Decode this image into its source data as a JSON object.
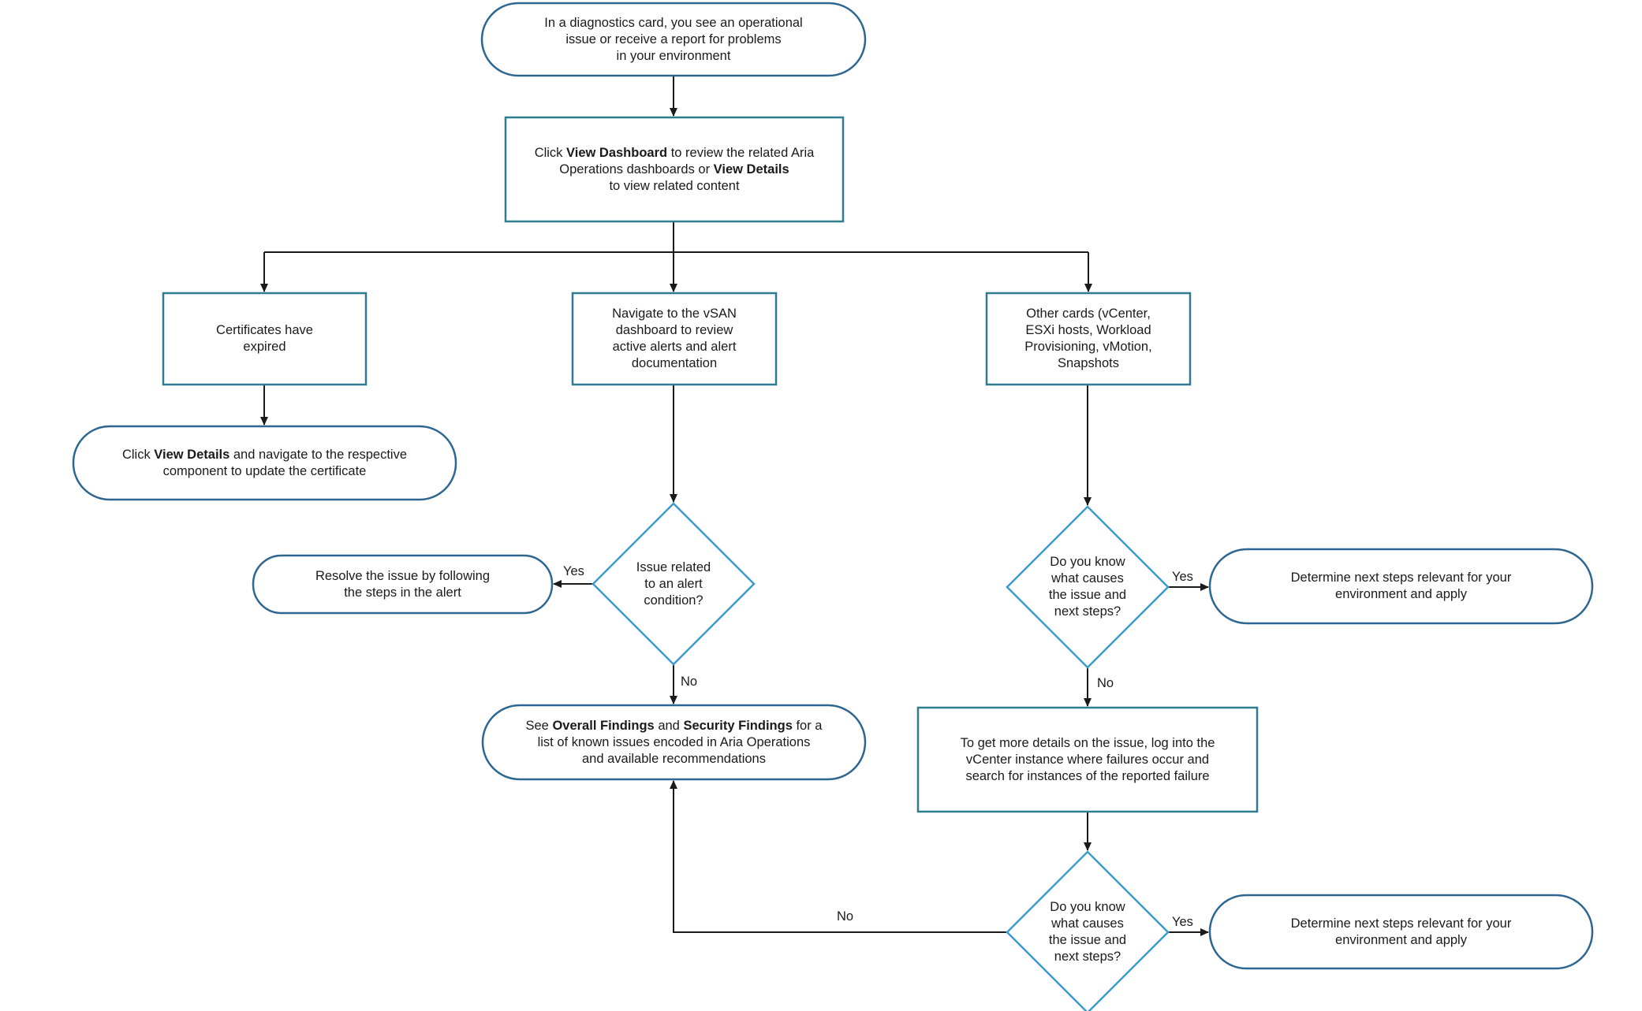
{
  "colors": {
    "pill_border": "#2d6690",
    "box_border": "#2e7d8f",
    "diamond_border": "#3d9bcb",
    "connector": "#1a1a1a",
    "text": "#1a1a1a"
  },
  "nodes": {
    "start": {
      "type": "terminator",
      "lines": [
        "In a diagnostics  card, you see an operational",
        "issue or receive a report for problems",
        "in your environment"
      ]
    },
    "view_dashboard": {
      "type": "process",
      "segments": [
        {
          "text": "Click ",
          "bold": false
        },
        {
          "text": "View Dashboard",
          "bold": true
        },
        {
          "text": " to review the related Aria\nOperations dashboards or ",
          "bold": false
        },
        {
          "text": "View Details",
          "bold": true
        },
        {
          "text": "\nto view related content",
          "bold": false
        }
      ]
    },
    "certificates_expired": {
      "type": "process",
      "lines": [
        "Certificates have",
        "expired"
      ]
    },
    "update_certificate": {
      "type": "terminator",
      "segments": [
        {
          "text": "Click ",
          "bold": false
        },
        {
          "text": "View Details",
          "bold": true
        },
        {
          "text": " and navigate to the respective\ncomponent to update the certificate",
          "bold": false
        }
      ]
    },
    "vsan_dashboard": {
      "type": "process",
      "lines": [
        "Navigate to the vSAN",
        "dashboard to review",
        "active alerts and alert",
        "documentation"
      ]
    },
    "other_cards": {
      "type": "process",
      "lines": [
        "Other cards (vCenter,",
        "ESXi hosts, Workload",
        "Provisioning, vMotion,",
        "Snapshots"
      ]
    },
    "alert_decision": {
      "type": "decision",
      "lines": [
        "Issue related",
        "to an alert",
        "condition?"
      ]
    },
    "resolve_alert": {
      "type": "terminator",
      "lines": [
        "Resolve the issue by following",
        "the steps in the alert"
      ]
    },
    "findings": {
      "type": "terminator",
      "segments": [
        {
          "text": "See ",
          "bold": false
        },
        {
          "text": "Overall Findings",
          "bold": true
        },
        {
          "text": " and ",
          "bold": false
        },
        {
          "text": "Security Findings",
          "bold": true
        },
        {
          "text": " for a\nlist of known issues encoded in Aria Operations\nand available recommendations",
          "bold": false
        }
      ]
    },
    "know_cause_1": {
      "type": "decision",
      "lines": [
        "Do you know",
        "what causes",
        "the issue and",
        "next steps?"
      ]
    },
    "next_steps_1": {
      "type": "terminator",
      "lines": [
        "Determine next steps relevant for your",
        "environment and apply"
      ]
    },
    "vcenter_details": {
      "type": "process",
      "lines": [
        "To get more details on the issue, log into the",
        "vCenter instance where failures occur and",
        "search for instances of the reported failure"
      ]
    },
    "know_cause_2": {
      "type": "decision",
      "lines": [
        "Do you know",
        "what causes",
        "the issue and",
        "next steps?"
      ]
    },
    "next_steps_2": {
      "type": "terminator",
      "lines": [
        "Determine next steps relevant for your",
        "environment and apply"
      ]
    }
  },
  "edge_labels": {
    "alert_yes": "Yes",
    "alert_no": "No",
    "know1_yes": "Yes",
    "know1_no": "No",
    "know2_yes": "Yes",
    "know2_no": "No"
  },
  "edges": [
    {
      "from": "start",
      "to": "view_dashboard"
    },
    {
      "from": "view_dashboard",
      "to": "certificates_expired"
    },
    {
      "from": "view_dashboard",
      "to": "vsan_dashboard"
    },
    {
      "from": "view_dashboard",
      "to": "other_cards"
    },
    {
      "from": "certificates_expired",
      "to": "update_certificate"
    },
    {
      "from": "vsan_dashboard",
      "to": "alert_decision"
    },
    {
      "from": "alert_decision",
      "to": "resolve_alert",
      "label": "Yes"
    },
    {
      "from": "alert_decision",
      "to": "findings",
      "label": "No"
    },
    {
      "from": "other_cards",
      "to": "know_cause_1"
    },
    {
      "from": "know_cause_1",
      "to": "next_steps_1",
      "label": "Yes"
    },
    {
      "from": "know_cause_1",
      "to": "vcenter_details",
      "label": "No"
    },
    {
      "from": "vcenter_details",
      "to": "know_cause_2"
    },
    {
      "from": "know_cause_2",
      "to": "next_steps_2",
      "label": "Yes"
    },
    {
      "from": "know_cause_2",
      "to": "findings",
      "label": "No"
    }
  ]
}
